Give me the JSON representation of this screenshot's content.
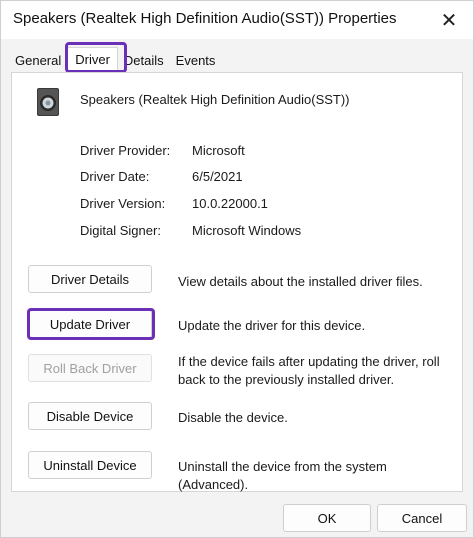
{
  "window": {
    "title": "Speakers (Realtek High Definition Audio(SST)) Properties",
    "close_glyph": "✕"
  },
  "tabs": [
    {
      "label": "General"
    },
    {
      "label": "Driver"
    },
    {
      "label": "Details"
    },
    {
      "label": "Events"
    }
  ],
  "active_tab": "Driver",
  "device": {
    "name": "Speakers (Realtek High Definition Audio(SST))",
    "icon": "speaker-icon"
  },
  "info": [
    {
      "label": "Driver Provider:",
      "value": "Microsoft"
    },
    {
      "label": "Driver Date:",
      "value": "6/5/2021"
    },
    {
      "label": "Driver Version:",
      "value": "10.0.22000.1"
    },
    {
      "label": "Digital Signer:",
      "value": "Microsoft Windows"
    }
  ],
  "actions": [
    {
      "label": "Driver Details",
      "description": "View details about the installed driver files.",
      "enabled": true
    },
    {
      "label": "Update Driver",
      "description": "Update the driver for this device.",
      "enabled": true
    },
    {
      "label": "Roll Back Driver",
      "description": "If the device fails after updating the driver, roll back to the previously installed driver.",
      "enabled": false
    },
    {
      "label": "Disable Device",
      "description": "Disable the device.",
      "enabled": true
    },
    {
      "label": "Uninstall Device",
      "description": "Uninstall the device from the system (Advanced).",
      "enabled": true
    }
  ],
  "footer": {
    "ok_label": "OK",
    "cancel_label": "Cancel"
  },
  "colors": {
    "highlight": "#6b2fb8"
  }
}
